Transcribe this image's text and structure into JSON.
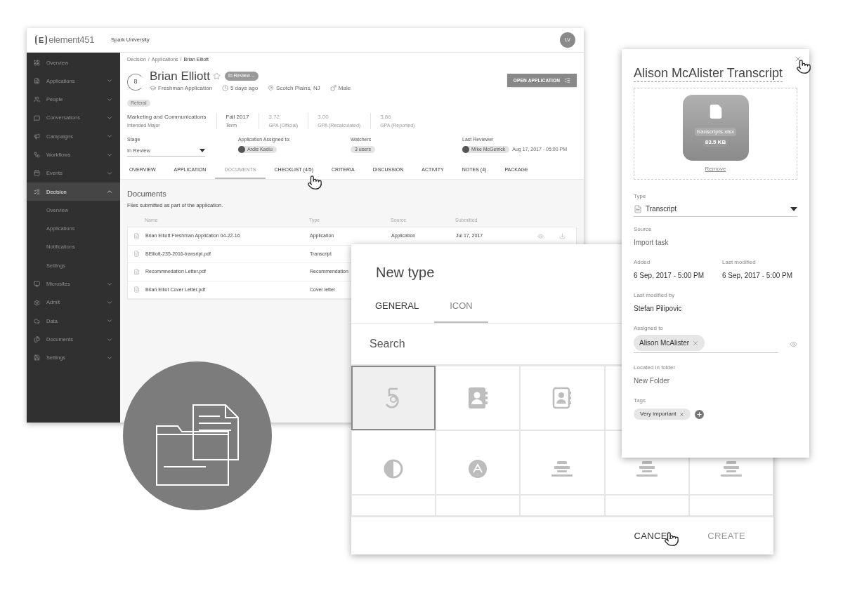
{
  "app": {
    "logo_mark": "E",
    "logo": "element451",
    "org": "Spark University",
    "avatar": "LV",
    "sidebar": [
      {
        "label": "Overview",
        "selected": false
      },
      {
        "label": "Applications",
        "expanded": false,
        "selected": false
      },
      {
        "label": "People",
        "expanded": false,
        "selected": false
      },
      {
        "label": "Conversations",
        "expanded": false,
        "selected": false
      },
      {
        "label": "Campaigns",
        "expanded": false,
        "selected": false
      },
      {
        "label": "Workflows",
        "expanded": false,
        "selected": false
      },
      {
        "label": "Events",
        "expanded": false,
        "selected": false
      },
      {
        "label": "Decision",
        "expanded": true,
        "selected": true,
        "children": [
          {
            "label": "Overview"
          },
          {
            "label": "Applications"
          },
          {
            "label": "Notifications"
          },
          {
            "label": "Settings"
          }
        ]
      },
      {
        "label": "Microsites",
        "expanded": false,
        "selected": false
      },
      {
        "label": "Admit",
        "expanded": false,
        "selected": false
      },
      {
        "label": "Data",
        "expanded": false,
        "selected": false
      },
      {
        "label": "Documents",
        "expanded": false,
        "selected": false
      },
      {
        "label": "Settings",
        "expanded": false,
        "selected": false
      }
    ],
    "breadcrumb": {
      "items": [
        "Decision",
        "Applications",
        "Brian Elliott"
      ],
      "separator": "/"
    },
    "applicant": {
      "score": "8",
      "name": "Brian Elliott",
      "starred": false,
      "status": "In Review",
      "application": "Freshman Application",
      "time": "5 days ago",
      "location": "Scotch Plains, NJ",
      "gender": "Male",
      "tag": "Referal"
    },
    "open_button": "OPEN APPLICATION",
    "stats": [
      {
        "value": "Marketing and Communications",
        "label": "Intended Major",
        "kind": "text"
      },
      {
        "value": "Fall 2017",
        "label": "Term",
        "kind": "text"
      },
      {
        "value": "3.72",
        "label": "GPA (Official)",
        "kind": "gpa"
      },
      {
        "value": "3.00",
        "label": "GPA (Recalculated)",
        "kind": "gpa"
      },
      {
        "value": "3.86",
        "label": "GPA (Reported)",
        "kind": "gpa"
      }
    ],
    "stage": {
      "label": "Stage",
      "value": "In Review"
    },
    "assigned": {
      "label": "Application Assigned to:",
      "person": "Ardis Kadiu"
    },
    "watchers": {
      "label": "Watchers",
      "value": "3 users"
    },
    "reviewer": {
      "label": "Last Reviewer",
      "person": "Mike McGetrick",
      "date": "Aug 17, 2017 - 05:00 PM"
    },
    "tabs": [
      {
        "label": "OVERVIEW",
        "selected": false
      },
      {
        "label": "APPLICATION",
        "selected": false
      },
      {
        "label": "DOCUMENTS",
        "selected": true
      },
      {
        "label": "CHECKLIST (4/5)",
        "selected": false
      },
      {
        "label": "CRITERIA",
        "selected": false
      },
      {
        "label": "DISCUSSION",
        "selected": false
      },
      {
        "label": "ACTIVITY",
        "selected": false
      },
      {
        "label": "NOTES (4)",
        "selected": false
      },
      {
        "label": "PACKAGE",
        "selected": false
      }
    ],
    "documents": {
      "title": "Documents",
      "subtitle": "Files submitted as part of the application.",
      "columns": [
        "Name",
        "Type",
        "Source",
        "Submitted"
      ],
      "rows": [
        {
          "name": "Brian Elliott Freshman Application 04-22-16",
          "type": "Application",
          "source": "Application",
          "submitted": "Jul 17, 2017"
        },
        {
          "name": "BElliott-235-2016-transript.pdf",
          "type": "Transcript"
        },
        {
          "name": "Recommnedation Letter.pdf",
          "type": "Recommendation"
        },
        {
          "name": "Brian Elliot Cover Letter.pdf",
          "type": "Cover letter"
        }
      ]
    }
  },
  "dialog": {
    "title": "New type",
    "tabs": [
      {
        "label": "GENERAL",
        "selected": false
      },
      {
        "label": "ICON",
        "selected": true
      }
    ],
    "search": {
      "placeholder": "Search"
    },
    "icons": [
      {
        "kind": "five",
        "selected": true
      },
      {
        "kind": "contact",
        "selected": false
      },
      {
        "kind": "contact-outline",
        "selected": false
      },
      {
        "kind": "none",
        "selected": false
      },
      {
        "kind": "contrast",
        "selected": false
      },
      {
        "kind": "a-circle",
        "selected": false
      },
      {
        "kind": "lines",
        "selected": false
      },
      {
        "kind": "lines",
        "selected": false
      },
      {
        "kind": "lines",
        "selected": false
      },
      {
        "kind": "none",
        "selected": false
      },
      {
        "kind": "none",
        "selected": false
      },
      {
        "kind": "none",
        "selected": false
      },
      {
        "kind": "none",
        "selected": false
      },
      {
        "kind": "none",
        "selected": false
      }
    ],
    "buttons": [
      {
        "label": "CANCEL",
        "disabled": false
      },
      {
        "label": "CREATE",
        "disabled": true
      }
    ]
  },
  "panel": {
    "title": "Alison McAlister Transcript",
    "file": {
      "name": "transcripts.xlsx",
      "size": "83.5 KB"
    },
    "remove": "Remove",
    "type": {
      "label": "Type",
      "value": "Transcript"
    },
    "source": {
      "label": "Source",
      "value": "Import task"
    },
    "added": {
      "label": "Added",
      "value": "6 Sep, 2017 - 5:00 PM"
    },
    "modified": {
      "label": "Last modified",
      "value": "6 Sep, 2017 - 5:00 PM"
    },
    "modified_by": {
      "label": "Last modified by",
      "value": "Stefan Pilipovic"
    },
    "assigned": {
      "label": "Assigned to",
      "chips": [
        "Alison McAlister"
      ]
    },
    "folder": {
      "label": "Located in folder",
      "value": "New Folder"
    },
    "tags": {
      "label": "Tags",
      "chips": [
        "Very important"
      ]
    }
  }
}
